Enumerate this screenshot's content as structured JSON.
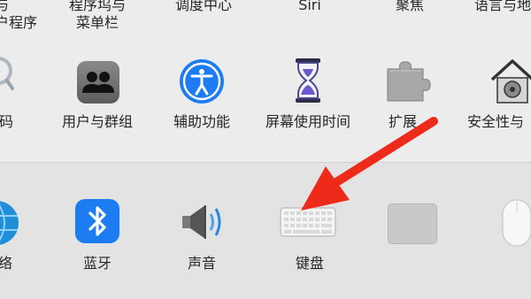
{
  "top_row": {
    "item0": {
      "line1": "与",
      "line2": "户程序"
    },
    "item1": {
      "line1": "程序坞与",
      "line2": "菜单栏"
    },
    "item2": {
      "label": "调度中心"
    },
    "item3": {
      "label": "Siri"
    },
    "item4": {
      "label": "聚焦"
    },
    "item5": {
      "label": "语言与地"
    }
  },
  "middle_row": {
    "item0": {
      "label": "码"
    },
    "item1": {
      "label": "用户与群组"
    },
    "item2": {
      "label": "辅助功能"
    },
    "item3": {
      "label": "屏幕使用时间"
    },
    "item4": {
      "label": "扩展"
    },
    "item5": {
      "label": "安全性与"
    }
  },
  "bottom_row": {
    "item0": {
      "label": "络"
    },
    "item1": {
      "label": "蓝牙"
    },
    "item2": {
      "label": "声音"
    },
    "item3": {
      "label": "键盘"
    },
    "item4": {
      "label": ""
    },
    "item5": {
      "label": ""
    }
  },
  "colors": {
    "arrow": "#ee2a1b",
    "accent": "#1e7cf2"
  }
}
